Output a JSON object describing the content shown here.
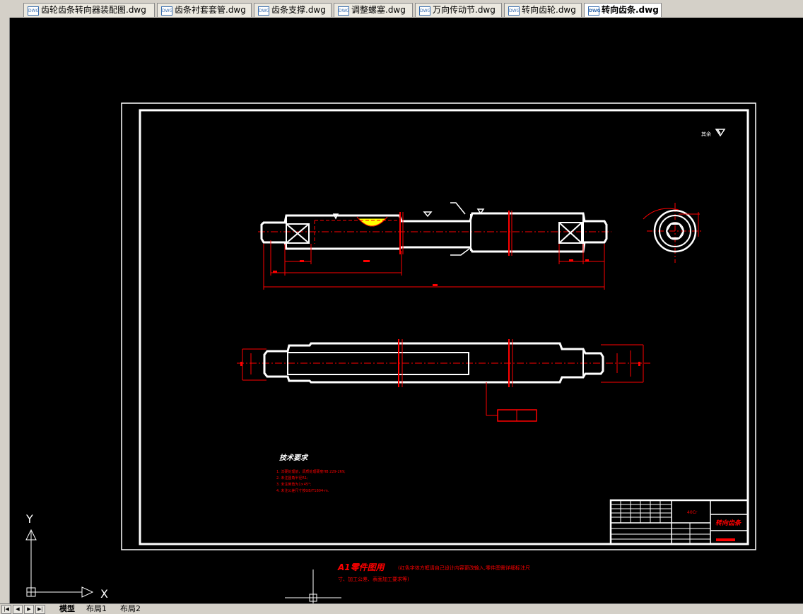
{
  "tabs": [
    {
      "label": "齿轮齿条转向器装配图.dwg",
      "active": false
    },
    {
      "label": "齿条衬套套管.dwg",
      "active": false
    },
    {
      "label": "齿条支撑.dwg",
      "active": false
    },
    {
      "label": "调整螺塞.dwg",
      "active": false
    },
    {
      "label": "万向传动节.dwg",
      "active": false
    },
    {
      "label": "转向齿轮.dwg",
      "active": false
    },
    {
      "label": "转向齿条.dwg",
      "active": true
    }
  ],
  "drawing": {
    "surface_note": "其余",
    "tech_req_title": "技术要求",
    "tech_req_items": [
      "1. 淬硬处理前，调质处理硬度HB 229-269;",
      "2. 未注圆角半径R1;",
      "3. 未注倒角为1×45°;",
      "4. 未注公差尺寸按GB/T1804-m."
    ],
    "title_block": {
      "material": "40Cr",
      "part_name": "转向齿条"
    },
    "a1_note": "A1零件图用",
    "a1_sub1": "(红色字体方框请自己设计内容更改输入,零件图需详细标注尺",
    "a1_sub2": "寸、加工公差、表面加工要求等)"
  },
  "ucs": {
    "x_label": "X",
    "y_label": "Y"
  },
  "layout_tabs": [
    {
      "label": "模型",
      "active": true
    },
    {
      "label": "布局1",
      "active": false
    },
    {
      "label": "布局2",
      "active": false
    }
  ],
  "colors": {
    "background": "#000000",
    "geometry": "#ffffff",
    "annotation": "#ff0000",
    "section_hatch": "#ffff00"
  }
}
